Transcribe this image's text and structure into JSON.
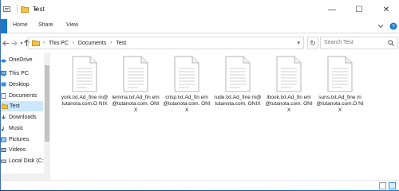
{
  "window": {
    "title": "Test",
    "controls": {
      "minimize": "—",
      "maximize": "☐",
      "close": "✕"
    }
  },
  "ribbon": {
    "tabs": [
      "Home",
      "Share",
      "View"
    ],
    "accent": "#1979ca"
  },
  "address": {
    "breadcrumbs": [
      "This PC",
      "Documents",
      "Test"
    ],
    "search_placeholder": "Search Test"
  },
  "nav_pane": {
    "items": [
      {
        "label": "OneDrive",
        "icon": "cloud-icon"
      },
      {
        "label": "This PC",
        "icon": "computer-icon"
      },
      {
        "label": "Desktop",
        "icon": "desktop-icon"
      },
      {
        "label": "Documents",
        "icon": "documents-icon"
      },
      {
        "label": "Test",
        "icon": "folder-icon",
        "selected": true
      },
      {
        "label": "Downloads",
        "icon": "downloads-icon"
      },
      {
        "label": "Music",
        "icon": "music-icon"
      },
      {
        "label": "Pictures",
        "icon": "pictures-icon"
      },
      {
        "label": "Videos",
        "icon": "videos-icon"
      },
      {
        "label": "Local Disk (C:)",
        "icon": "drive-icon"
      }
    ]
  },
  "files": [
    {
      "name": "york.txt.Ad_fine m@tutanota.com.O NIX",
      "icon": "text-file-icon"
    },
    {
      "name": "lemma.txt.Ad_fin em@tutanota.com. ONIX",
      "icon": "text-file-icon"
    },
    {
      "name": "crisp.txt.Ad_fin em@tutanota.com. ONIX",
      "icon": "text-file-icon"
    },
    {
      "name": "rude.txt.Ad_fine m@tutanota.com. ONIX",
      "icon": "text-file-icon"
    },
    {
      "name": "ibook.txt.Ad_fin em@tutanota.com. ONIX",
      "icon": "text-file-icon"
    },
    {
      "name": "suns.txt.Ad_fine m@tutanota.com.O NIX",
      "icon": "text-file-icon"
    }
  ],
  "colors": {
    "selection": "#cce8ff",
    "folder": "#f0c24b",
    "desktop_blue": "#1565c0"
  }
}
